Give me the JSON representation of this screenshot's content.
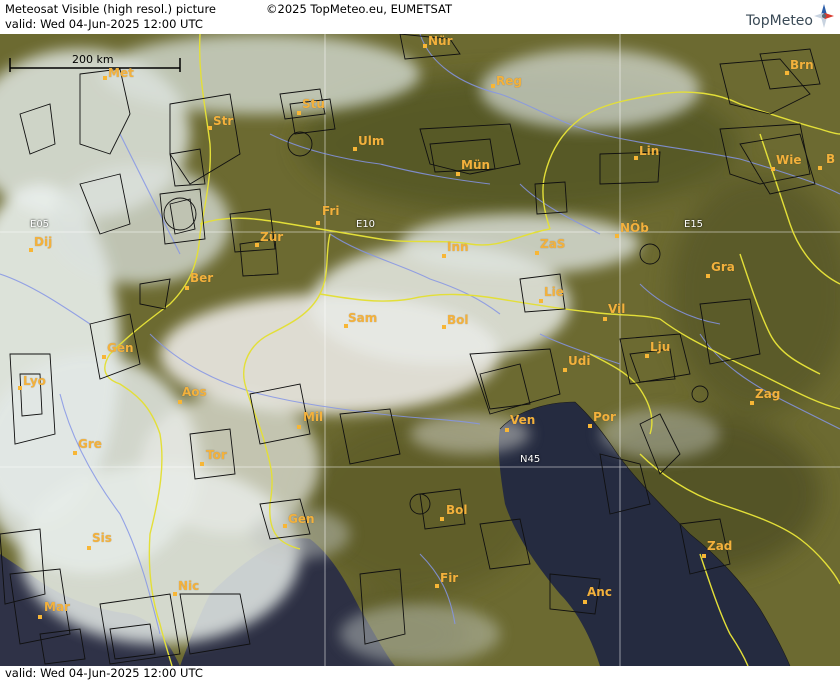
{
  "header": {
    "title": "Meteosat Visible (high resol.) picture",
    "copyright": "©2025 TopMeteo.eu, EUMETSAT",
    "valid": "valid:  Wed  04-Jun-2025  12:00 UTC",
    "logo_text": "TopMeteo",
    "logo_icon": "compass-icon"
  },
  "footer": {
    "valid": "valid:  Wed  04-Jun-2025  12:00 UTC"
  },
  "scale_bar": {
    "label": "200 km"
  },
  "grid_labels": {
    "lon_e05": "E05",
    "lon_e10": "E10",
    "lon_e15": "E15",
    "lat_n45": "N45"
  },
  "colors": {
    "land": "#6e6a32",
    "land_dark": "#4a4a22",
    "sea": "#2a3046",
    "cloud": "#e6ece8",
    "border": "#e6e23a",
    "river": "#8a9ce8",
    "city": "#f3b13c",
    "grid": "#ffffff"
  },
  "cities": [
    {
      "name": "Nür"
    },
    {
      "name": "Met"
    },
    {
      "name": "Reg"
    },
    {
      "name": "Brn"
    },
    {
      "name": "Str"
    },
    {
      "name": "Stu"
    },
    {
      "name": "Ulm"
    },
    {
      "name": "Lin"
    },
    {
      "name": "Wie"
    },
    {
      "name": "B"
    },
    {
      "name": "Mün"
    },
    {
      "name": "Fri"
    },
    {
      "name": "NÖb"
    },
    {
      "name": "Dij"
    },
    {
      "name": "Zür"
    },
    {
      "name": "Inn"
    },
    {
      "name": "ZaS"
    },
    {
      "name": "Gra"
    },
    {
      "name": "Ber"
    },
    {
      "name": "Lie"
    },
    {
      "name": "Vil"
    },
    {
      "name": "Sam"
    },
    {
      "name": "Bol"
    },
    {
      "name": "Gen"
    },
    {
      "name": "Lju"
    },
    {
      "name": "Udi"
    },
    {
      "name": "Lyo"
    },
    {
      "name": "Aos"
    },
    {
      "name": "Mil"
    },
    {
      "name": "Ven"
    },
    {
      "name": "Por"
    },
    {
      "name": "Zag"
    },
    {
      "name": "Gre"
    },
    {
      "name": "Tor"
    },
    {
      "name": "Gen"
    },
    {
      "name": "Bol"
    },
    {
      "name": "Sis"
    },
    {
      "name": "Zad"
    },
    {
      "name": "Nic"
    },
    {
      "name": "Fir"
    },
    {
      "name": "Anc"
    },
    {
      "name": "Mar"
    }
  ]
}
